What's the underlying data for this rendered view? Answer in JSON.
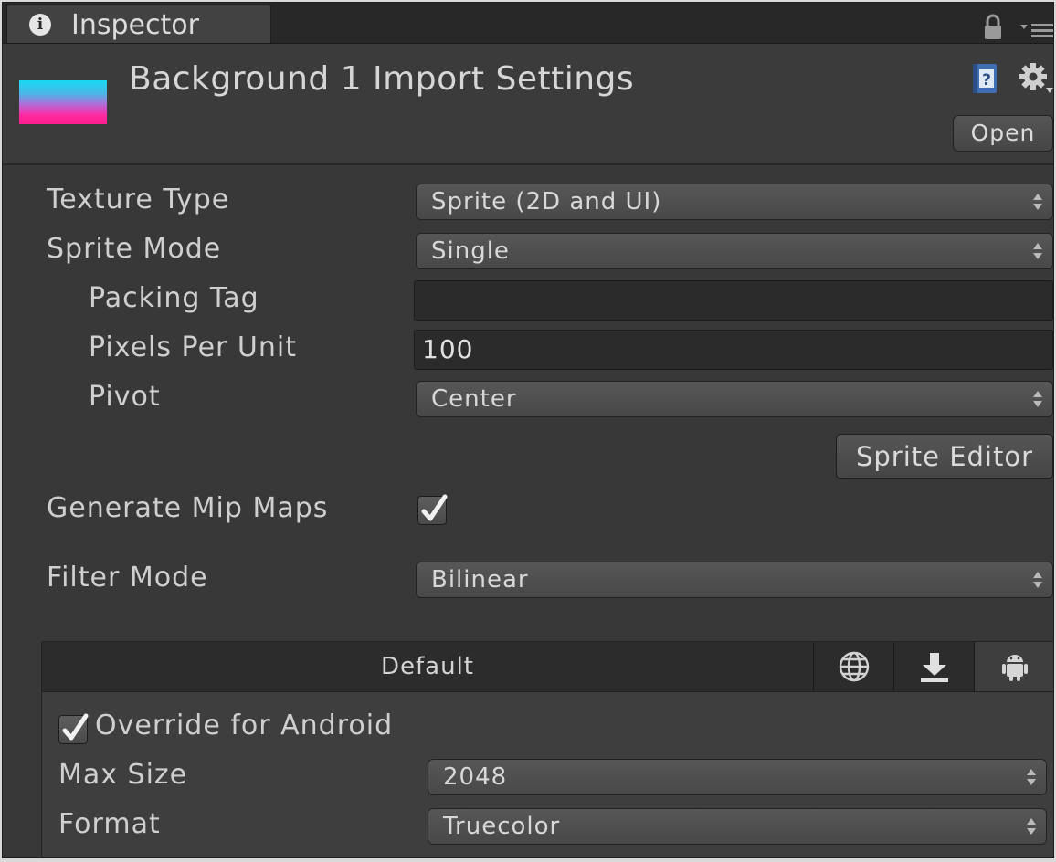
{
  "window": {
    "tab_label": "Inspector",
    "icons": [
      "info-icon",
      "lock-icon",
      "menu-icon"
    ]
  },
  "header": {
    "title": "Background 1 Import Settings",
    "open_label": "Open",
    "icons": [
      "help-icon",
      "gear-icon"
    ]
  },
  "properties": {
    "texture_type": {
      "label": "Texture Type",
      "value": "Sprite (2D and UI)"
    },
    "sprite_mode": {
      "label": "Sprite Mode",
      "value": "Single"
    },
    "packing_tag": {
      "label": "Packing Tag",
      "value": ""
    },
    "pixels_per_unit": {
      "label": "Pixels Per Unit",
      "value": "100"
    },
    "pivot": {
      "label": "Pivot",
      "value": "Center"
    },
    "sprite_editor_label": "Sprite Editor",
    "generate_mip_maps": {
      "label": "Generate Mip Maps",
      "checked": true
    },
    "filter_mode": {
      "label": "Filter Mode",
      "value": "Bilinear"
    }
  },
  "platform": {
    "tabs": [
      {
        "label": "Default",
        "icon": null,
        "active": false
      },
      {
        "label": "",
        "icon": "globe-icon",
        "active": false
      },
      {
        "label": "",
        "icon": "download-icon",
        "active": false
      },
      {
        "label": "",
        "icon": "android-icon",
        "active": true
      }
    ],
    "override": {
      "label": "Override for Android",
      "checked": true
    },
    "max_size": {
      "label": "Max Size",
      "value": "2048"
    },
    "format": {
      "label": "Format",
      "value": "Truecolor"
    }
  }
}
